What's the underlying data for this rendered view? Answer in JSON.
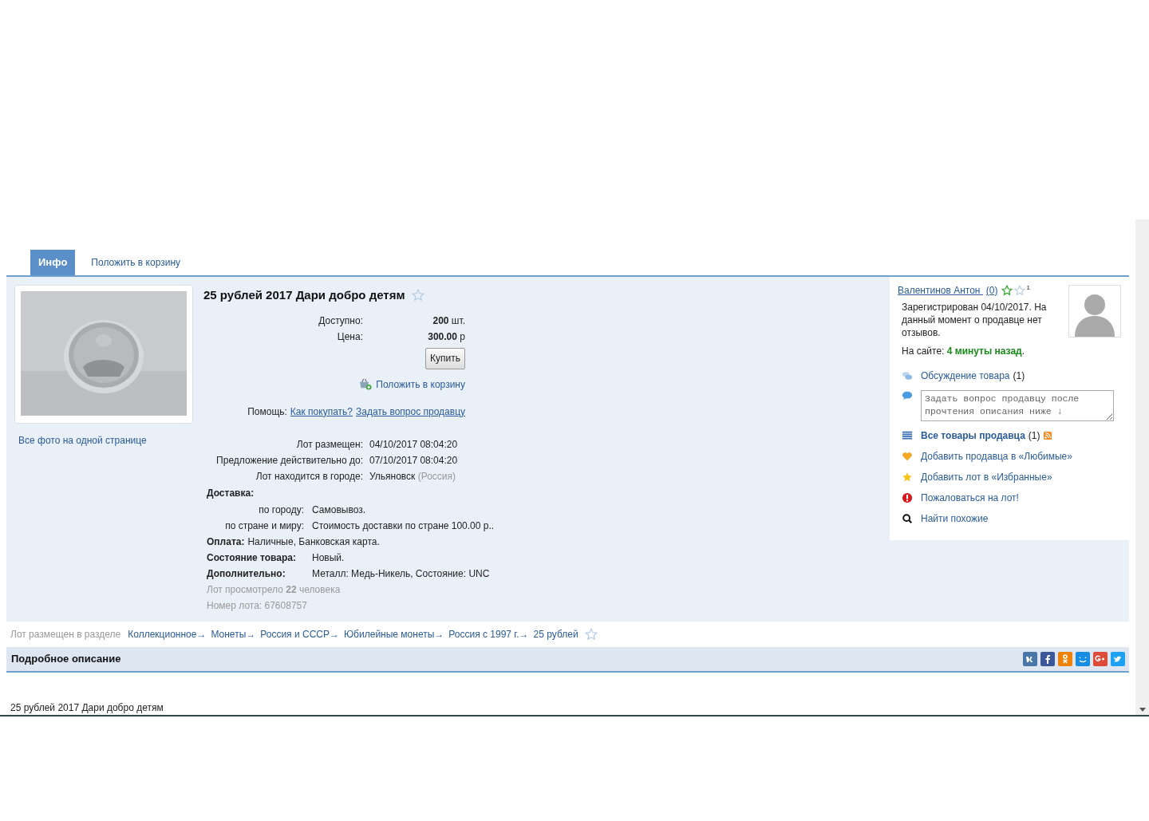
{
  "tabs": [
    {
      "label": "Инфо",
      "selected": true
    },
    {
      "label": "Положить в корзину",
      "selected": false
    }
  ],
  "photo": {
    "kind": "picture",
    "all_photos_link": "Все фото на одной странице"
  },
  "lot": {
    "title": "25 рублей 2017 Дари добро детям",
    "stock": [
      {
        "label": "Доступно:",
        "value": "200",
        "unit": "шт."
      },
      {
        "label": "Цена:",
        "value": "300.00",
        "unit": "р"
      }
    ],
    "buy_button": "Купить",
    "cart_link": "Положить в корзину",
    "help": {
      "label": "Помощь:",
      "links": [
        "Как покупать?",
        "Задать вопрос продавцу"
      ]
    },
    "dates": [
      {
        "label": "Лот размещен:",
        "value": "04/10/2017 08:04:20"
      },
      {
        "label": "Предложение действительно до:",
        "value": "07/10/2017 08:04:20"
      },
      {
        "label": "Лот находится в городе:",
        "value": "Ульяновск",
        "note": "(Россия)"
      }
    ],
    "delivery": {
      "label": "Доставка:",
      "rows": [
        {
          "label": "по городу:",
          "value": "Самовывоз."
        },
        {
          "label": "по стране и миру:",
          "value": "Стоимость доставки по стране 100.00 р.."
        }
      ]
    },
    "payment": {
      "label": "Оплата:",
      "value": "Наличные, Банковская карта."
    },
    "condition": {
      "label": "Состояние товара:",
      "value": "Новый."
    },
    "extra": {
      "label": "Дополнительно:",
      "value": "Металл: Медь-Никель, Состояние: UNC"
    },
    "views": "Лот просмотрело **22** человека",
    "lot_number": "Номер лота: 67608757"
  },
  "seller": {
    "name": "Валентинов Антон ",
    "rating": "(0)",
    "badge_count": "1",
    "registered": "Зарегистрирован 04/10/2017. На данный момент о продавце нет отзывов.",
    "online_label": "На сайте:",
    "online_value": "4 минуты назад",
    "online_suffix": ".",
    "actions": [
      {
        "kind": "discussion",
        "label": "Обсуждение товара",
        "count": "(1)"
      },
      {
        "kind": "question",
        "placeholder": "Задать вопрос продавцу после прочтения описания ниже ↓"
      },
      {
        "kind": "all_items",
        "label": "Все товары продавца",
        "count": "(1)"
      },
      {
        "kind": "favorite_seller",
        "label": "Добавить продавца в «Любимые»"
      },
      {
        "kind": "favorite_lot",
        "label": "Добавить лот в «Избранные»"
      },
      {
        "kind": "complain",
        "label": "Пожаловаться на лот!"
      },
      {
        "kind": "similar",
        "label": "Найти похожие"
      }
    ]
  },
  "breadcrumb": {
    "label": "Лот размещен в разделе",
    "items": [
      "Коллекционное→",
      "Монеты→",
      "Россия и СССР→",
      "Юбилейные монеты→",
      "Россия с 1997 г.→",
      "25 рублей"
    ]
  },
  "description": {
    "heading": "Подробное описание",
    "body": "25 рублей 2017 Дари добро детям"
  },
  "share": [
    {
      "kind": "vk",
      "color": "#4a76a8"
    },
    {
      "kind": "fb",
      "color": "#3b5998"
    },
    {
      "kind": "ok",
      "color": "#ee8208"
    },
    {
      "kind": "mailru",
      "color": "#168de2"
    },
    {
      "kind": "gplus",
      "color": "#dd4b39"
    },
    {
      "kind": "tw",
      "color": "#1da1f2"
    }
  ]
}
